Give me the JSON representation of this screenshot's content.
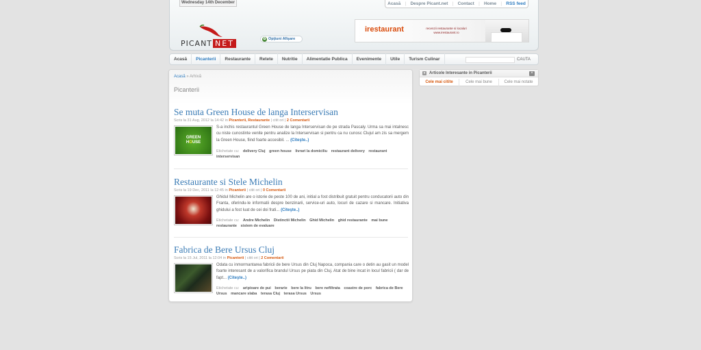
{
  "header": {
    "date": "Wednesday 14th December",
    "top_links": [
      "Acasă",
      "Despre Picant.net",
      "Contact",
      "Home",
      "RSS feed"
    ],
    "logo_text": "PICANT",
    "logo_suffix": "NET",
    "options_label": "Opţiuni Afişare",
    "banner": {
      "brand": "irestaurant",
      "tagline": "recenzii restaurante si localuri",
      "url": "www.irestaurant.ro"
    }
  },
  "nav": {
    "items": [
      "Acasă",
      "Picanterii",
      "Restaurante",
      "Retete",
      "Nutritie",
      "Alimentatie Publica",
      "Evenimente",
      "Utile",
      "Turism Culinar"
    ],
    "active_index": 1,
    "search_placeholder": "",
    "search_button": "CAUTA"
  },
  "breadcrumb": {
    "home": "Acasă",
    "sep": "»",
    "current": "Arhivă"
  },
  "page_title": "Picanterii",
  "posts": [
    {
      "title": "Se muta Green House de langa Interservisan",
      "meta_prefix": "Scris la 31 Aug, 2012 la 14:42 in",
      "categories": "Picanterii, Restaurante",
      "reads": "| citit ori |",
      "comments": "2 Comentarii",
      "thumb_text_1": "GREEN",
      "thumb_text_2": "H",
      "thumb_text_3": "O",
      "thumb_text_4": "USE",
      "excerpt": "S-a inchis restaurantul Green House de langa Interservisan de pe strada Pascaly. Urma sa mai intalnesc cu niste cunostinte venite pentru analize la Interservisan si pentru ca nu cunosc Clujul am zis sa mergem la Green House, fiind  foarte accesibil. ...",
      "more": "(Citeşte..)",
      "tags_label": "Etichetate cu:",
      "tags": [
        "delivery Cluj",
        "green house",
        "livrari la domiciliu",
        "restaurant delivery",
        "restaurant interservisan"
      ]
    },
    {
      "title": "Restaurante si Stele Michelin",
      "meta_prefix": "Scris la 19 Dec, 2011 la 12:45 in",
      "categories": "Picanterii",
      "reads": "| citit ori |",
      "comments": "0 Comentarii",
      "excerpt": "Ghidul Michelin are  o istorie de peste 100 de ani, initial a fost distribuit gratuit pentru conducatorii auto din Franta, oferindu-le informatii despre benzinarii, service-uri auto, locuri de cazare si mancare. Initiativa ghidului a fost luat de cei doi frati...",
      "more": "(Citeşte..)",
      "tags_label": "Etichetate cu:",
      "tags": [
        "Andre Michelin",
        "Distinctii Michelin",
        "Ghid Michelin",
        "ghid restaurante",
        "mai bune restaurante",
        "sistem de evaluare"
      ]
    },
    {
      "title": "Fabrica de Bere Ursus Cluj",
      "meta_prefix": "Scris la 15 Jul, 2011 la 12:04 in",
      "categories": "Picanterii",
      "reads": "| citit ori |",
      "comments": "2 Comentarii",
      "excerpt": "Odata cu inmormantarea fabricii de bere Ursus din Cluj Napoca, compania care o detin au gasit un model foarte interesant de a valorifica brandul Ursus pe piata din Cluj. Atat de bine incat in locul fabricii ( dar de fapt...",
      "more": "(Citeşte..)",
      "tags_label": "Etichetate cu:",
      "tags": [
        "aripioare de pui",
        "berarie",
        "bere la litru",
        "bere nefiltrata",
        "coastre de porc",
        "fabrica de Bere Ursus",
        "mancare slaba",
        "terasa Cluj",
        "terasa Ursus",
        "Ursus"
      ]
    }
  ],
  "widget": {
    "title": "Articole Interesante in Picanterii",
    "toggle": "▾",
    "close": "×",
    "tabs": [
      "Cele mai citite",
      "Cele mai bune",
      "Cele mai notate"
    ],
    "active_tab": 0
  },
  "colors": {
    "background": "#e3e3e3",
    "link_blue": "#3a7bb5",
    "accent_orange": "#d65a10",
    "logo_red": "#c51a1a"
  }
}
